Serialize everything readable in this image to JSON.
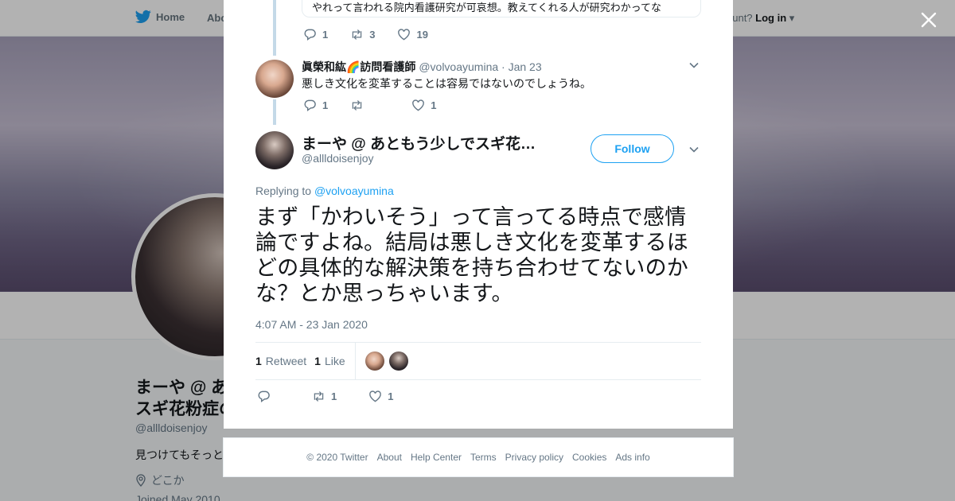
{
  "nav": {
    "home": "Home",
    "about": "Abo",
    "account": "ccount?",
    "login": "Log in"
  },
  "profile": {
    "name": "まーや @ あ",
    "name_line2": "スギ花粉症の",
    "handle": "@allldoisenjoy",
    "bio": "見つけてもそっと",
    "location": "どこか",
    "joined": "Joined May 2010"
  },
  "thread": {
    "quoted_text": "やれって言われる院内看護研究が可哀想。教えてくれる人が研究わかってな",
    "top_actions": {
      "replies": "1",
      "retweets": "3",
      "likes": "19"
    },
    "reply": {
      "name": "眞榮和紘🌈訪問看護師",
      "handle": "@volvoayumina",
      "date": "· Jan 23",
      "text": "悪しき文化を変革することは容易ではないのでしょうね。",
      "actions": {
        "replies": "1",
        "retweets": "",
        "likes": "1"
      }
    }
  },
  "main_tweet": {
    "name": "まーや @ あともう少しでスギ花粉症の季節",
    "handle": "@allldoisenjoy",
    "follow_label": "Follow",
    "replying_prefix": "Replying to ",
    "replying_to": "@volvoayumina",
    "text": "まず「かわいそう」って言ってる時点で感情論ですよね。結局は悪しき文化を変革するほどの具体的な解決策を持ち合わせてないのかな？とか思っちゃいます。",
    "timestamp": "4:07 AM - 23 Jan 2020",
    "retweet_count": "1",
    "retweet_label": "Retweet",
    "like_count": "1",
    "like_label": "Like",
    "actions": {
      "replies": "",
      "retweets": "1",
      "likes": "1"
    }
  },
  "footer": {
    "copyright": "© 2020 Twitter",
    "links": [
      "About",
      "Help Center",
      "Terms",
      "Privacy policy",
      "Cookies",
      "Ads info"
    ]
  },
  "colors": {
    "brand": "#1da1f2",
    "muted": "#657786",
    "thread_line": "#c4d9e8"
  }
}
